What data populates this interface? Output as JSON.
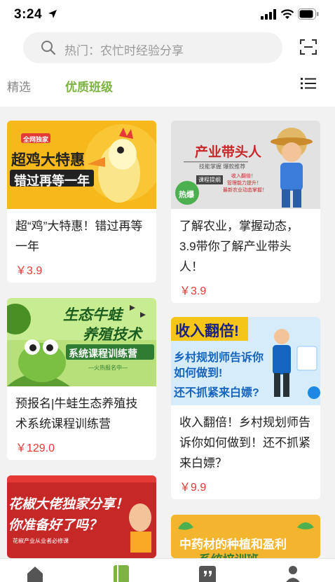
{
  "status_bar": {
    "time": "3:24"
  },
  "search": {
    "placeholder": "热门：农忙时经验分享"
  },
  "tabs": [
    {
      "label": "精选",
      "active": false
    },
    {
      "label": "优质班级",
      "active": true
    }
  ],
  "cards": [
    {
      "banner": {
        "badge": "全网独家",
        "line1": "超鸡大特惠",
        "line2": "错过再等一年"
      },
      "title": "超“鸡”大特惠！错过再等一年",
      "price": "￥3.9"
    },
    {
      "banner": {
        "heading": "产业带头人",
        "sub": "技能掌握  爆款推荐",
        "tag": "课程提纲",
        "bullets": [
          "收入翻倍！",
          "管理能力提升！",
          "最新农业动态掌握！"
        ],
        "badge": "热爆"
      },
      "title": "了解农业，掌握动态，3.9带你了解产业带头人！",
      "price": "￥3.9"
    },
    {
      "banner": {
        "line1": "生态牛蛙",
        "line2": "养殖技术",
        "ribbon": "系统课程训练营",
        "small": "—火热报名中—"
      },
      "title": "预报名|牛蛙生态养殖技术系统课程训练营",
      "price": "￥129.0"
    },
    {
      "banner": {
        "heading": "收入翻倍!",
        "line1": "乡村规划师告诉你",
        "line2": "如何做到!",
        "line3": "还不抓紧来白嫖?"
      },
      "title": "收入翻倍！乡村规划师告诉你如何做到！还不抓紧来白嫖？",
      "price": "￥9.9"
    },
    {
      "banner": {
        "line1": "花椒大佬独家分享！",
        "line2": "你准备好了吗？",
        "small": "花椒产业从业者必修课"
      }
    },
    {
      "banner": {
        "line1": "中药材的种植和盈利",
        "line2": "系统培训班"
      }
    }
  ],
  "colors": {
    "accent": "#7cb342",
    "price": "#e53935"
  },
  "nav_icons": [
    "home-icon",
    "course-book-icon",
    "message-quote-icon",
    "profile-icon"
  ]
}
